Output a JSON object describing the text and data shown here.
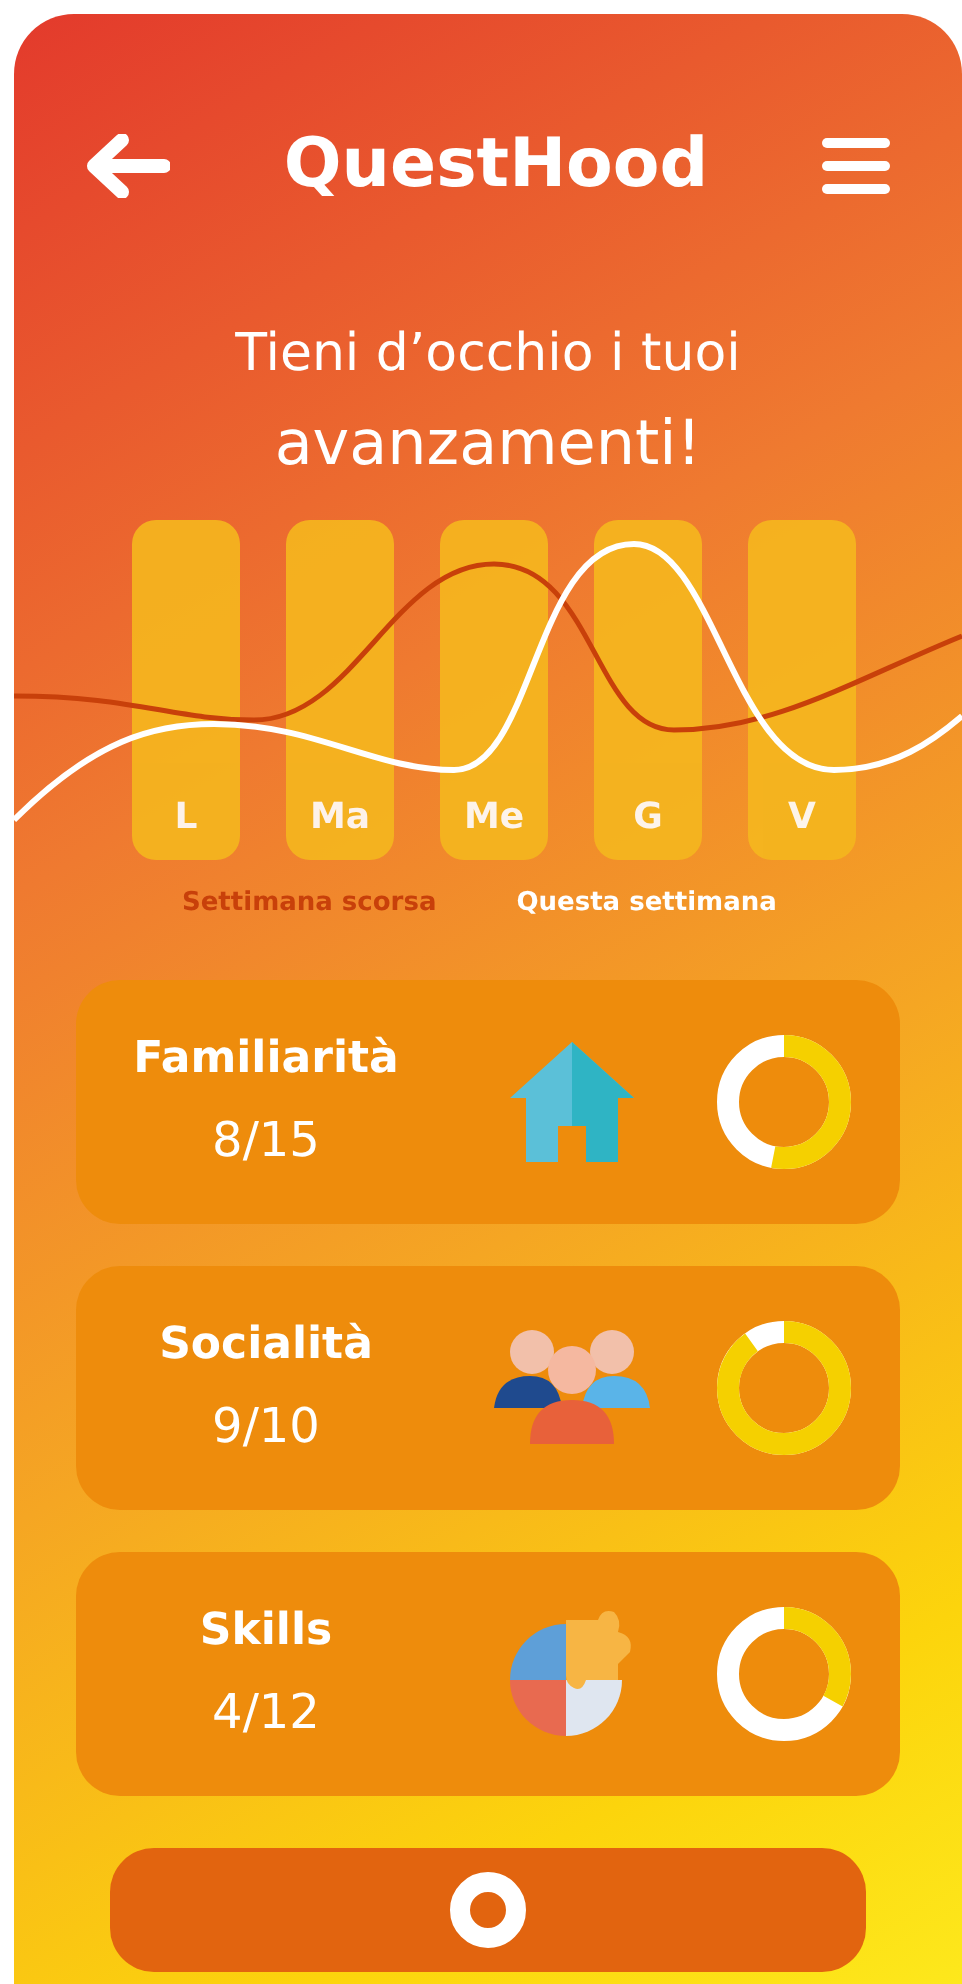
{
  "header": {
    "title": "QuestHood"
  },
  "heading": {
    "line_1": "Tieni d’occhio i tuoi",
    "line_2": "avanzamenti!"
  },
  "days": [
    {
      "label": "L"
    },
    {
      "label": "Ma"
    },
    {
      "label": "Me"
    },
    {
      "label": "G"
    },
    {
      "label": "V"
    }
  ],
  "legend": [
    {
      "label": "Settimana scorsa",
      "color": "#c8400a"
    },
    {
      "label": "Questa settimana",
      "color": "#ffffff"
    }
  ],
  "categories": [
    {
      "name": "Familiarità",
      "score": "8/15",
      "kind": "house",
      "level": 0.53
    },
    {
      "name": "Socialità",
      "score": "9/10",
      "kind": "people",
      "level": 0.9
    },
    {
      "name": "Skills",
      "score": "4/12",
      "kind": "puzzle",
      "level": 0.33
    }
  ]
}
